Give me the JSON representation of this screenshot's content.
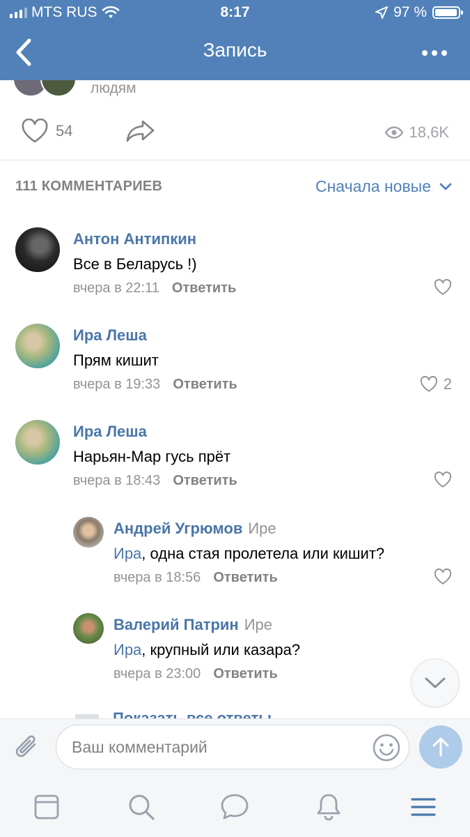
{
  "status_bar": {
    "carrier": "MTS RUS",
    "time": "8:17",
    "battery": "97 %"
  },
  "header": {
    "title": "Запись"
  },
  "post": {
    "people_text": "людям",
    "likes": "54",
    "views": "18,6K"
  },
  "comments_section": {
    "count_label": "111 КОММЕНТАРИЕВ",
    "sort_label": "Сначала новые"
  },
  "comments": [
    {
      "author": "Антон Антипкин",
      "text": "Все в Беларусь !)",
      "time": "вчера в 22:11",
      "reply_label": "Ответить",
      "likes": ""
    },
    {
      "author": "Ира Леша",
      "text": "Прям кишит",
      "time": "вчера в 19:33",
      "reply_label": "Ответить",
      "likes": "2"
    },
    {
      "author": "Ира Леша",
      "text": "Нарьян-Мар гусь прёт",
      "time": "вчера в 18:43",
      "reply_label": "Ответить",
      "likes": ""
    },
    {
      "author": "Андрей Угрюмов",
      "reply_to": "Ире",
      "mention": "Ира",
      "text": ", одна стая пролетела или кишит?",
      "time": "вчера в 18:56",
      "reply_label": "Ответить",
      "likes": ""
    },
    {
      "author": "Валерий Патрин",
      "reply_to": "Ире",
      "mention": "Ира",
      "text": ", крупный или казара?",
      "time": "вчера в 23:00",
      "reply_label": "Ответить"
    }
  ],
  "show_all_replies": "Показать все ответы",
  "composer": {
    "placeholder": "Ваш комментарий"
  },
  "colors": {
    "header": "#5181b8",
    "link": "#4a76a8",
    "meta": "#939393",
    "send": "#aecbea"
  },
  "icons": {
    "back": "chevron-left-icon",
    "more": "more-dots-icon",
    "like": "heart-icon",
    "share": "share-arrow-icon",
    "views": "eye-icon",
    "sort": "chevron-down-icon",
    "attach": "paperclip-icon",
    "emoji": "smiley-icon",
    "send": "arrow-up-icon",
    "tabs": [
      "feed-icon",
      "search-icon",
      "messages-icon",
      "notifications-icon",
      "menu-icon"
    ]
  }
}
